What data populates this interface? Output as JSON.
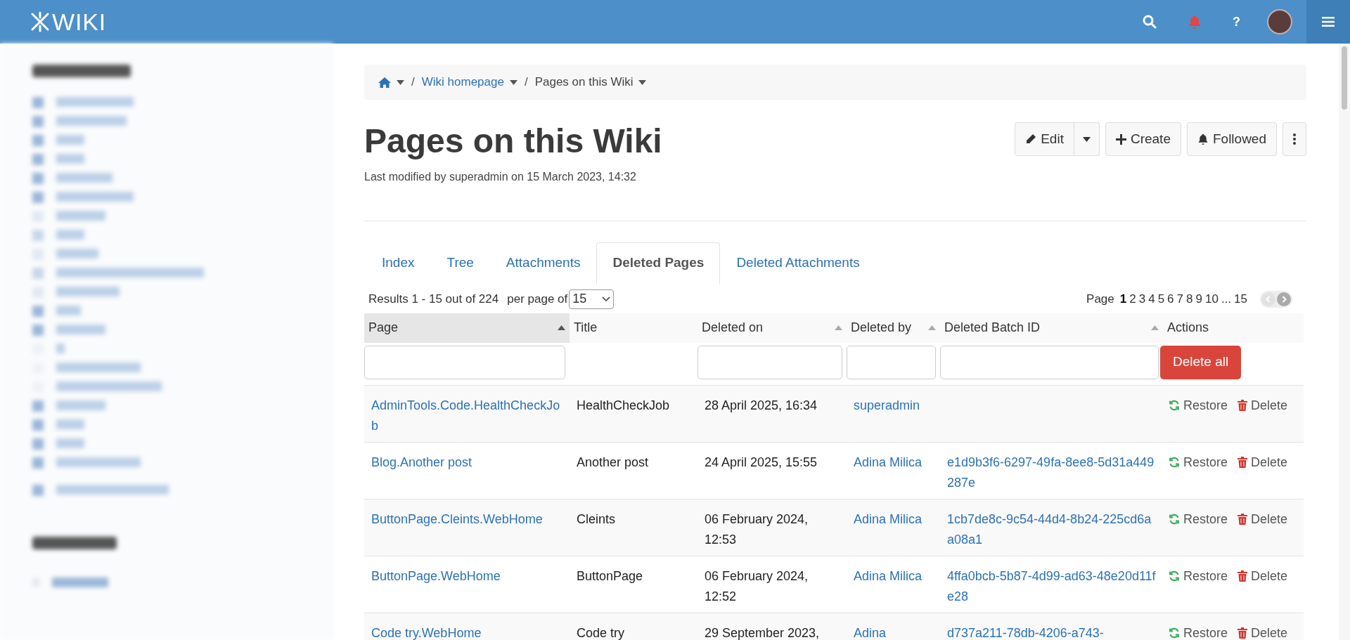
{
  "topbar": {
    "logo_text": "WIKI",
    "help": "?",
    "notifications": true
  },
  "breadcrumb_separator": "/",
  "breadcrumb": [
    {
      "kind": "home"
    },
    {
      "kind": "link",
      "label": "Wiki homepage"
    },
    {
      "kind": "current",
      "label": "Pages on this Wiki"
    }
  ],
  "title": "Pages on this Wiki",
  "last_modified": "Last modified by superadmin on 15 March 2023, 14:32",
  "page_actions": [
    {
      "kind": "edit",
      "label": "Edit"
    },
    {
      "kind": "caret"
    },
    {
      "kind": "create",
      "label": "Create"
    },
    {
      "kind": "followed",
      "label": "Followed"
    },
    {
      "kind": "more"
    }
  ],
  "tabs": [
    {
      "label": "Index",
      "selected": false
    },
    {
      "label": "Tree",
      "selected": false
    },
    {
      "label": "Attachments",
      "selected": false
    },
    {
      "label": "Deleted Pages",
      "selected": true
    },
    {
      "label": "Deleted Attachments",
      "selected": false
    }
  ],
  "results": {
    "summary": "Results 1 - 15 out of 224",
    "per_page_label": "per page of",
    "per_page": "15"
  },
  "pagination": {
    "label": "Page",
    "pages": [
      {
        "label": "1",
        "selected": true
      },
      {
        "label": "2",
        "selected": false
      },
      {
        "label": "3",
        "selected": false
      },
      {
        "label": "4",
        "selected": false
      },
      {
        "label": "5",
        "selected": false
      },
      {
        "label": "6",
        "selected": false
      },
      {
        "label": "7",
        "selected": false
      },
      {
        "label": "8",
        "selected": false
      },
      {
        "label": "9",
        "selected": false
      },
      {
        "label": "10",
        "selected": false
      },
      {
        "label": "...",
        "selected": false
      },
      {
        "label": "15",
        "selected": false
      }
    ]
  },
  "table": {
    "columns": [
      {
        "label": "Page",
        "sortable": true,
        "sorted": true,
        "filter": true
      },
      {
        "label": "Title",
        "sortable": false,
        "sorted": false,
        "filter": false
      },
      {
        "label": "Deleted on",
        "sortable": true,
        "sorted": false,
        "filter": true
      },
      {
        "label": "Deleted by",
        "sortable": true,
        "sorted": false,
        "filter": true
      },
      {
        "label": "Deleted Batch ID",
        "sortable": true,
        "sorted": false,
        "filter": true
      },
      {
        "label": "Actions",
        "sortable": false,
        "sorted": false,
        "filter": false,
        "button": "Delete all"
      }
    ],
    "rows": [
      {
        "page": "AdminTools.Code.HealthCheckJob",
        "title": "HealthCheckJob",
        "deleted_on": "28 April 2025, 16:34",
        "deleted_by": "superadmin",
        "batch_id": "",
        "restore": "Restore",
        "delete": "Delete"
      },
      {
        "page": "Blog.Another post",
        "title": "Another post",
        "deleted_on": "24 April 2025, 15:55",
        "deleted_by": "Adina Milica",
        "batch_id": "e1d9b3f6-6297-49fa-8ee8-5d31a449287e",
        "restore": "Restore",
        "delete": "Delete"
      },
      {
        "page": "ButtonPage.Cleints.WebHome",
        "title": "Cleints",
        "deleted_on": "06 February 2024, 12:53",
        "deleted_by": "Adina Milica",
        "batch_id": "1cb7de8c-9c54-44d4-8b24-225cd6aa08a1",
        "restore": "Restore",
        "delete": "Delete"
      },
      {
        "page": "ButtonPage.WebHome",
        "title": "ButtonPage",
        "deleted_on": "06 February 2024, 12:52",
        "deleted_by": "Adina Milica",
        "batch_id": "4ffa0bcb-5b87-4d99-ad63-48e20d11fe28",
        "restore": "Restore",
        "delete": "Delete"
      },
      {
        "page": "Code try.WebHome",
        "title": "Code try",
        "deleted_on": "29 September 2023,",
        "deleted_by": "Adina",
        "batch_id": "d737a211-78db-4206-a743-",
        "restore": "Restore",
        "delete": "Delete"
      }
    ]
  }
}
